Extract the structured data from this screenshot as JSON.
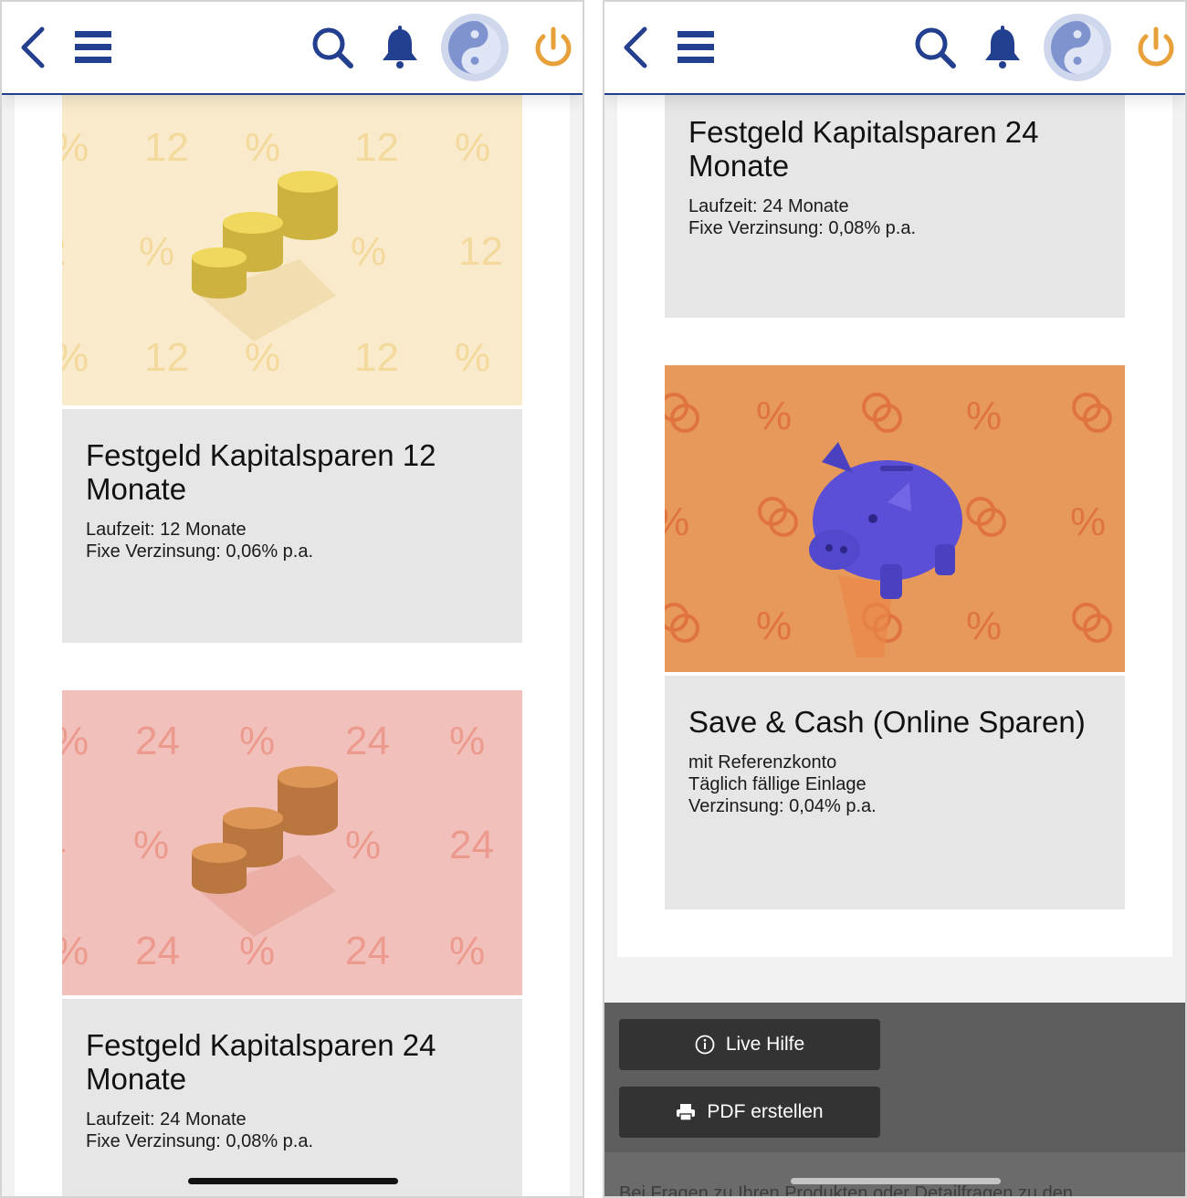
{
  "colors": {
    "brand_blue": "#233f8f",
    "power_orange": "#e8a13a",
    "card_gray": "#e6e6e6",
    "coins12_bg": "#f8eacb",
    "coins24_bg": "#f2c0bb",
    "piggy_bg": "#e6995a"
  },
  "toolbar": {
    "back_icon": "chevron-left-icon",
    "menu_icon": "hamburger-icon",
    "search_icon": "search-icon",
    "bell_icon": "bell-icon",
    "avatar_icon": "yin-yang-avatar",
    "power_icon": "power-icon"
  },
  "left": {
    "cards": [
      {
        "title": "Festgeld Kapitalsparen 12 Monate",
        "line1": "Laufzeit: 12 Monate",
        "line2": "Fixe Verzinsung: 0,06% p.a.",
        "pattern_number": "12"
      },
      {
        "title": "Festgeld Kapitalsparen 24 Monate",
        "line1": "Laufzeit: 24 Monate",
        "line2": "Fixe Verzinsung: 0,08% p.a.",
        "pattern_number": "24"
      }
    ]
  },
  "right": {
    "cards": [
      {
        "title": "Festgeld Kapitalsparen 24 Monate",
        "line1": "Laufzeit: 24 Monate",
        "line2": "Fixe Verzinsung: 0,08% p.a."
      },
      {
        "title": "Save & Cash (Online Sparen)",
        "line1": "mit Referenzkonto",
        "line2": "Täglich fällige Einlage",
        "line3": "Verzinsung: 0,04% p.a."
      }
    ],
    "footer": {
      "live_help": "Live Hilfe",
      "pdf": "PDF erstellen",
      "text": "Bei Fragen zu Ihren Produkten oder Detailfragen zu den"
    }
  }
}
